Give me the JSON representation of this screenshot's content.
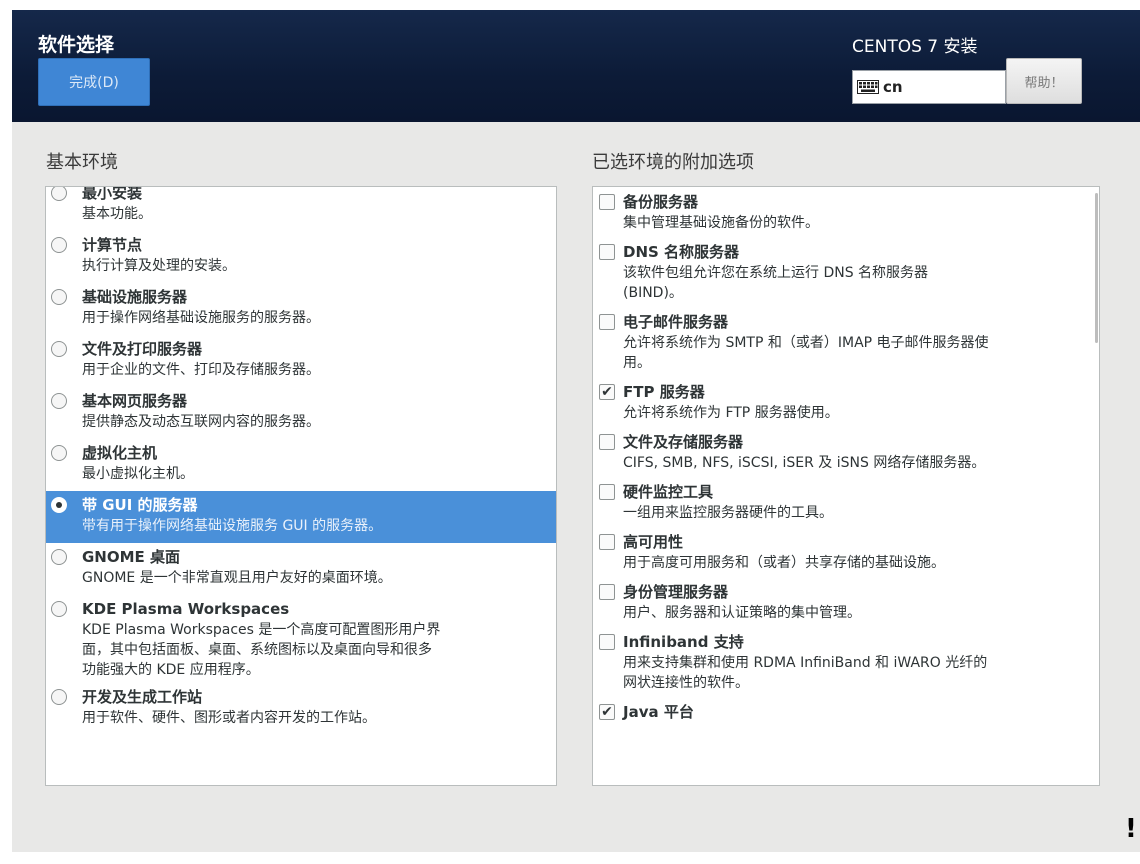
{
  "header": {
    "title": "软件选择",
    "done_label": "完成(D)",
    "product": "CENTOS 7 安装",
    "keyboard_layout": "cn",
    "help_label": "帮助！"
  },
  "left": {
    "title": "基本环境",
    "items": [
      {
        "name": "最小安装",
        "desc": [
          "基本功能。"
        ],
        "selected": false
      },
      {
        "name": "计算节点",
        "desc": [
          "执行计算及处理的安装。"
        ],
        "selected": false
      },
      {
        "name": "基础设施服务器",
        "desc": [
          "用于操作网络基础设施服务的服务器。"
        ],
        "selected": false
      },
      {
        "name": "文件及打印服务器",
        "desc": [
          "用于企业的文件、打印及存储服务器。"
        ],
        "selected": false
      },
      {
        "name": "基本网页服务器",
        "desc": [
          "提供静态及动态互联网内容的服务器。"
        ],
        "selected": false
      },
      {
        "name": "虚拟化主机",
        "desc": [
          "最小虚拟化主机。"
        ],
        "selected": false
      },
      {
        "name": "带 GUI 的服务器",
        "desc": [
          "带有用于操作网络基础设施服务 GUI 的服务器。"
        ],
        "selected": true
      },
      {
        "name": "GNOME 桌面",
        "desc": [
          "GNOME 是一个非常直观且用户友好的桌面环境。"
        ],
        "selected": false
      },
      {
        "name": "KDE Plasma Workspaces",
        "desc": [
          "KDE Plasma Workspaces 是一个高度可配置图形用户界",
          "面，其中包括面板、桌面、系统图标以及桌面向导和很多",
          "功能强大的 KDE 应用程序。"
        ],
        "selected": false
      },
      {
        "name": "开发及生成工作站",
        "desc": [
          "用于软件、硬件、图形或者内容开发的工作站。"
        ],
        "selected": false
      }
    ]
  },
  "right": {
    "title": "已选环境的附加选项",
    "items": [
      {
        "name": "备份服务器",
        "desc": [
          "集中管理基础设施备份的软件。"
        ],
        "checked": false
      },
      {
        "name": "DNS 名称服务器",
        "desc": [
          "该软件包组允许您在系统上运行 DNS 名称服务器",
          "(BIND)。"
        ],
        "checked": false
      },
      {
        "name": "电子邮件服务器",
        "desc": [
          "允许将系统作为 SMTP 和（或者）IMAP 电子邮件服务器使",
          "用。"
        ],
        "checked": false
      },
      {
        "name": "FTP 服务器",
        "desc": [
          "允许将系统作为 FTP 服务器使用。"
        ],
        "checked": true
      },
      {
        "name": "文件及存储服务器",
        "desc": [
          "CIFS, SMB, NFS, iSCSI, iSER 及 iSNS 网络存储服务器。"
        ],
        "checked": false
      },
      {
        "name": "硬件监控工具",
        "desc": [
          "一组用来监控服务器硬件的工具。"
        ],
        "checked": false
      },
      {
        "name": "高可用性",
        "desc": [
          "用于高度可用服务和（或者）共享存储的基础设施。"
        ],
        "checked": false
      },
      {
        "name": "身份管理服务器",
        "desc": [
          "用户、服务器和认证策略的集中管理。"
        ],
        "checked": false
      },
      {
        "name": "Infiniband 支持",
        "desc": [
          "用来支持集群和使用 RDMA InfiniBand 和 iWARO 光纤的",
          "网状连接性的软件。"
        ],
        "checked": false
      },
      {
        "name": "Java 平台",
        "desc": [],
        "checked": true
      }
    ]
  },
  "stray_mark": "!",
  "icons": {
    "keyboard": "keyboard-icon",
    "radio": "radio-icon",
    "checkbox": "checkbox-icon",
    "check": "checkmark-icon"
  },
  "colors": {
    "header": "#0f2244",
    "selection": "#4a90d9",
    "done_button": "#3f86d5"
  }
}
